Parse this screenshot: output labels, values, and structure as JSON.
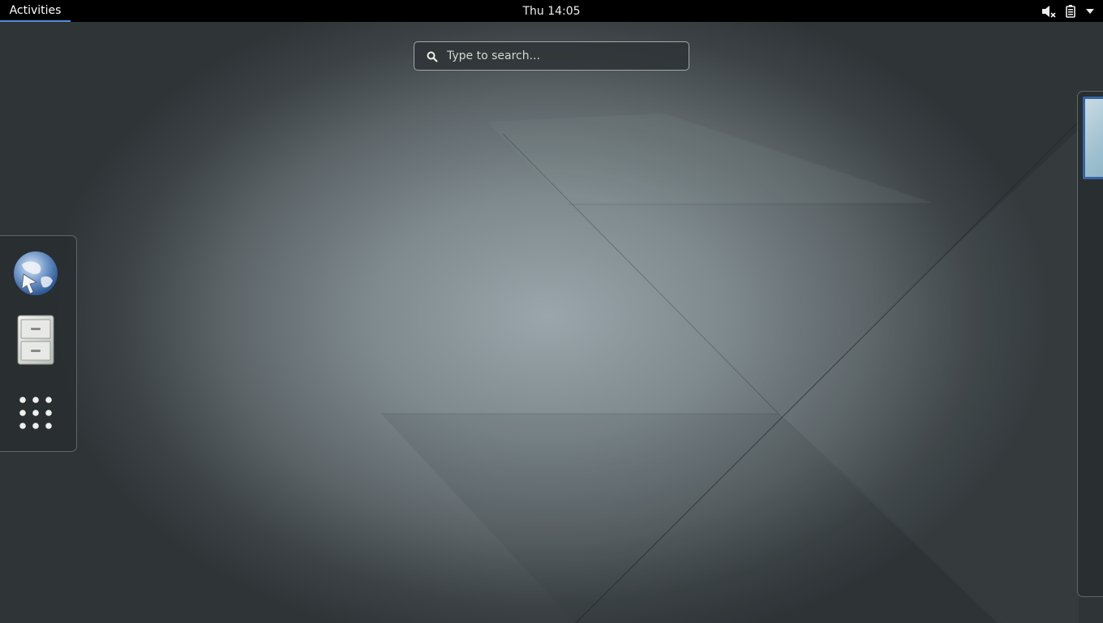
{
  "topbar": {
    "activities_label": "Activities",
    "clock": "Thu 14:05",
    "status_icons": [
      "volume-muted-icon",
      "battery-icon",
      "system-menu-arrow-icon"
    ]
  },
  "search": {
    "placeholder": "Type to search..."
  },
  "dash": {
    "items": [
      {
        "name": "web-browser",
        "icon": "globe-icon"
      },
      {
        "name": "files",
        "icon": "file-cabinet-icon"
      },
      {
        "name": "show-applications",
        "icon": "app-grid-icon"
      }
    ]
  },
  "workspaces": {
    "count_visible": 1,
    "active_color": "#3465a4"
  },
  "colors": {
    "topbar": "#000000",
    "accent": "#4a90d9",
    "desktop_center": "#9aa6ab",
    "desktop_edge": "#2f3437"
  }
}
